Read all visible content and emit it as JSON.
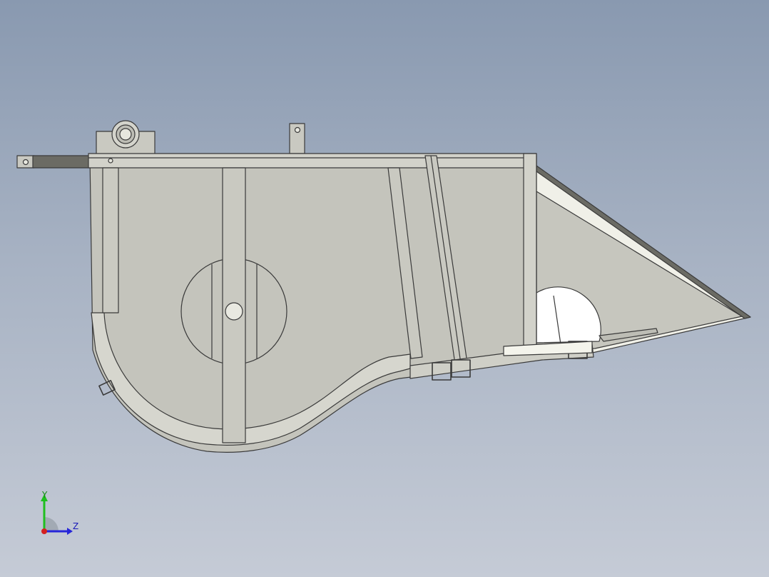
{
  "viewport": {
    "background_top": "#8999b0",
    "background_bottom": "#c5cbd6"
  },
  "model": {
    "description_icon": "sheet-metal-hopper-part",
    "body_color": "#c4c4bc",
    "edge_color": "#3a3a3a",
    "highlight_color": "#f2f2ea",
    "dark_strip_color": "#6b6b64"
  },
  "triad": {
    "y_label": "Y",
    "z_label": "Z",
    "y_color": "#1fbf1f",
    "z_color": "#2626d9",
    "x_color": "#d42020"
  }
}
